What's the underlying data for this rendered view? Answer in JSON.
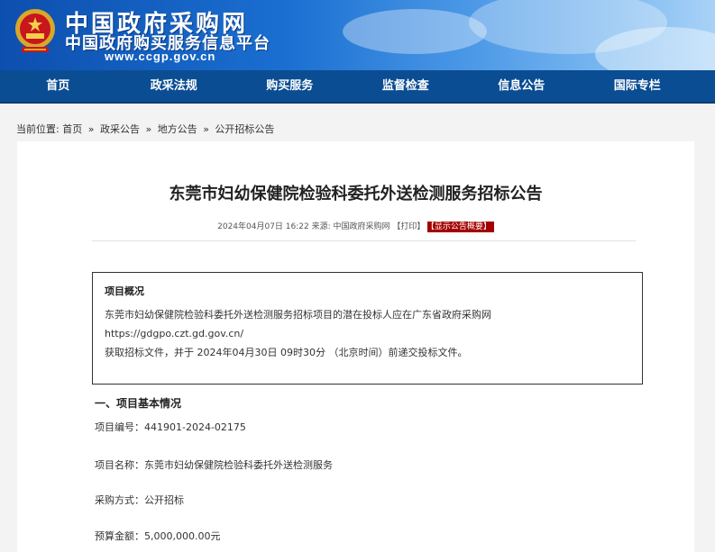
{
  "header": {
    "title_line1": "中国政府采购网",
    "title_line2": "中国政府购买服务信息平台",
    "url": "www.ccgp.gov.cn"
  },
  "nav": {
    "items": [
      "首页",
      "政采法规",
      "购买服务",
      "监督检查",
      "信息公告",
      "国际专栏"
    ]
  },
  "breadcrumb": {
    "prefix": "当前位置:",
    "items": [
      "首页",
      "政采公告",
      "地方公告",
      "公开招标公告"
    ],
    "separator": "»"
  },
  "article": {
    "title": "东莞市妇幼保健院检验科委托外送检测服务招标公告",
    "meta_text": "2024年04月07日 16:22 来源: 中国政府采购网 【打印】",
    "summary_badge": "【显示公告概要】",
    "overview": {
      "title": "项目概况",
      "line1": "东莞市妇幼保健院检验科委托外送检测服务招标项目的潜在投标人应在广东省政府采购网",
      "line2": "https://gdgpo.czt.gd.gov.cn/",
      "line3": "获取招标文件，并于 2024年04月30日 09时30分 （北京时间）前递交投标文件。"
    },
    "section_heading": "一、项目基本情况",
    "fields": {
      "project_no": "项目编号：441901-2024-02175",
      "project_name": "项目名称：东莞市妇幼保健院检验科委托外送检测服务",
      "method": "采购方式：公开招标",
      "budget": "预算金额：5,000,000.00元"
    }
  },
  "colors": {
    "nav_bg": "#0b4d93",
    "badge_bg": "#a40000"
  }
}
